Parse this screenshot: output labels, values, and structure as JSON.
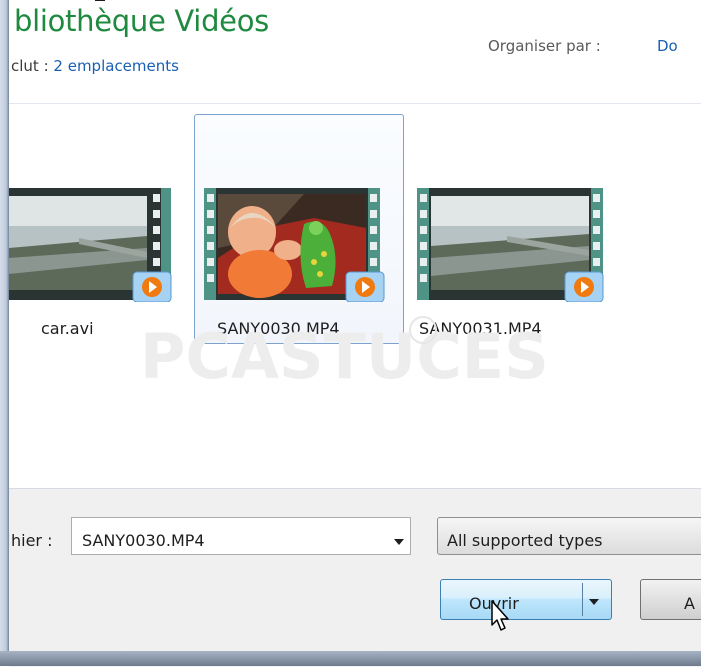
{
  "library": {
    "title": "bliothèque Vidéos",
    "includes_label": "clut :",
    "includes_link": "2 emplacements",
    "organise_label": "Organiser par :",
    "organise_value": "Do"
  },
  "files": [
    {
      "name": "car.avi",
      "selected": false,
      "icon": "video-thumbnail-highway"
    },
    {
      "name": "SANY0030.MP4",
      "selected": true,
      "icon": "video-thumbnail-baby"
    },
    {
      "name": "SANY0031.MP4",
      "selected": false,
      "icon": "video-thumbnail-highway"
    }
  ],
  "watermark": {
    "text": "PCASTUCES"
  },
  "footer": {
    "filename_label": "hier :",
    "filename_value": "SANY0030.MP4",
    "filetype_value": "All supported types",
    "open_button": "Ouvrir",
    "cancel_button": "A"
  },
  "colors": {
    "title_green": "#1f8a3f",
    "link_blue": "#1a5fb4",
    "selection_border": "#7da2ce"
  }
}
